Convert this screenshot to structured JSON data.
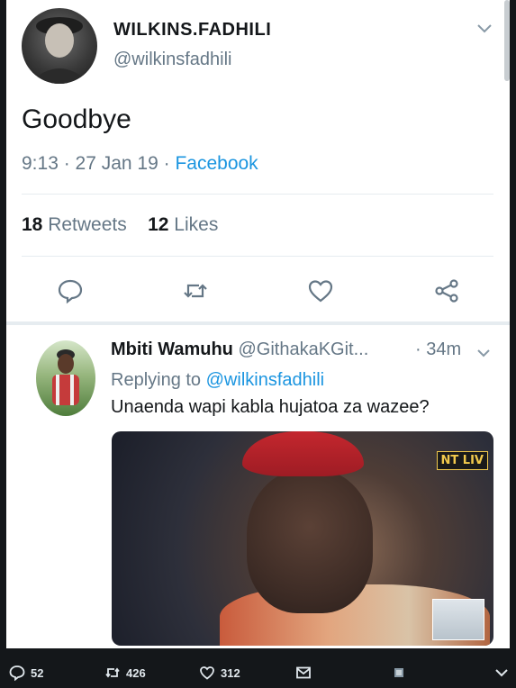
{
  "tweet": {
    "display_name": "WILKINS.FADHILI",
    "handle": "@wilkinsfadhili",
    "text": "Goodbye",
    "meta_time": "9:13 · 27 Jan 19 · ",
    "meta_source": "Facebook",
    "retweets_count": "18",
    "retweets_label": "Retweets",
    "likes_count": "12",
    "likes_label": "Likes"
  },
  "actions": [
    {
      "icon": "reply-icon"
    },
    {
      "icon": "retweet-icon"
    },
    {
      "icon": "heart-icon"
    },
    {
      "icon": "share-icon"
    }
  ],
  "reply": {
    "name": "Mbiti Wamuhu",
    "handle": "@GithakaKGit...",
    "time": "· 34m",
    "replying_prefix": "Replying to ",
    "replying_to": "@wilkinsfadhili",
    "text": "Unaenda wapi kabla hujatoa za wazee?",
    "media_logo": "NT LIV"
  },
  "bottom_bar": {
    "replies": "52",
    "retweets": "426",
    "likes": "312"
  },
  "colors": {
    "link": "#1b95e0",
    "muted": "#657786",
    "text": "#14171a",
    "bar_bg": "#14171a"
  }
}
